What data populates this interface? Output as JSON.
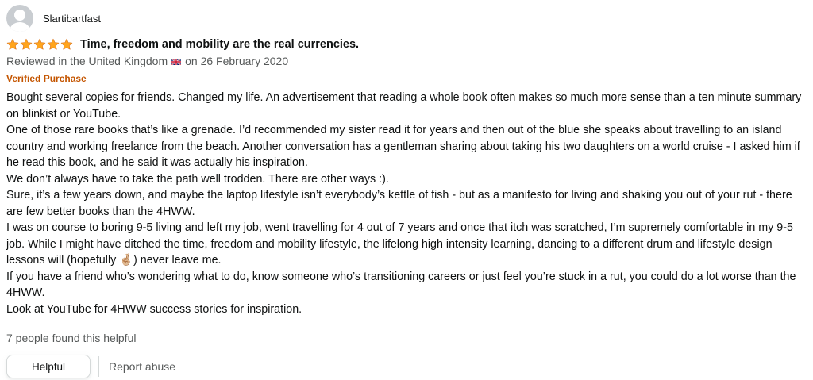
{
  "review": {
    "profile_name": "Slartibartfast",
    "rating": 5,
    "title": "Time, freedom and mobility are the real currencies.",
    "date_prefix": "Reviewed in the United Kingdom",
    "country_flag": "uk-flag-icon",
    "date_suffix": "on 26 February 2020",
    "verified_label": "Verified Purchase",
    "body": [
      "Bought several copies for friends. Changed my life. An advertisement that reading a whole book often makes so much more sense than a ten minute summary on blinkist or YouTube.",
      "One of those rare books that’s like a grenade. I’d recommended my sister read it for years and then out of the blue she speaks about travelling to an island country and working freelance from the beach. Another conversation has a gentleman sharing about taking his two daughters on a world cruise - I asked him if he read this book, and he said it was actually his inspiration.",
      "We don’t always have to take the path well trodden. There are other ways :).",
      "Sure, it’s a few years down, and maybe the laptop lifestyle isn’t everybody’s kettle of fish - but as a manifesto for living and shaking you out of your rut - there are few better books than the 4HWW.",
      "I was on course to boring 9-5 living and left my job, went travelling for 4 out of 7 years and once that itch was scratched, I’m supremely comfortable in my 9-5 job. While I might have ditched the time, freedom and mobility lifestyle, the lifelong high intensity learning, dancing to a different drum and lifestyle design lessons will (hopefully 🤞🏼) never leave me.",
      "If you have a friend who’s wondering what to do, know someone who’s transitioning careers or just feel you’re stuck in a rut, you could do a lot worse than the 4HWW.",
      "Look at YouTube for 4HWW success stories for inspiration."
    ],
    "helpful_count_text": "7 people found this helpful",
    "helpful_button_label": "Helpful",
    "report_label": "Report abuse"
  },
  "colors": {
    "star": "#ffa41c",
    "verified": "#c45500",
    "secondary_text": "#565959",
    "primary_text": "#0f1111",
    "button_border": "#d5d9d9"
  }
}
